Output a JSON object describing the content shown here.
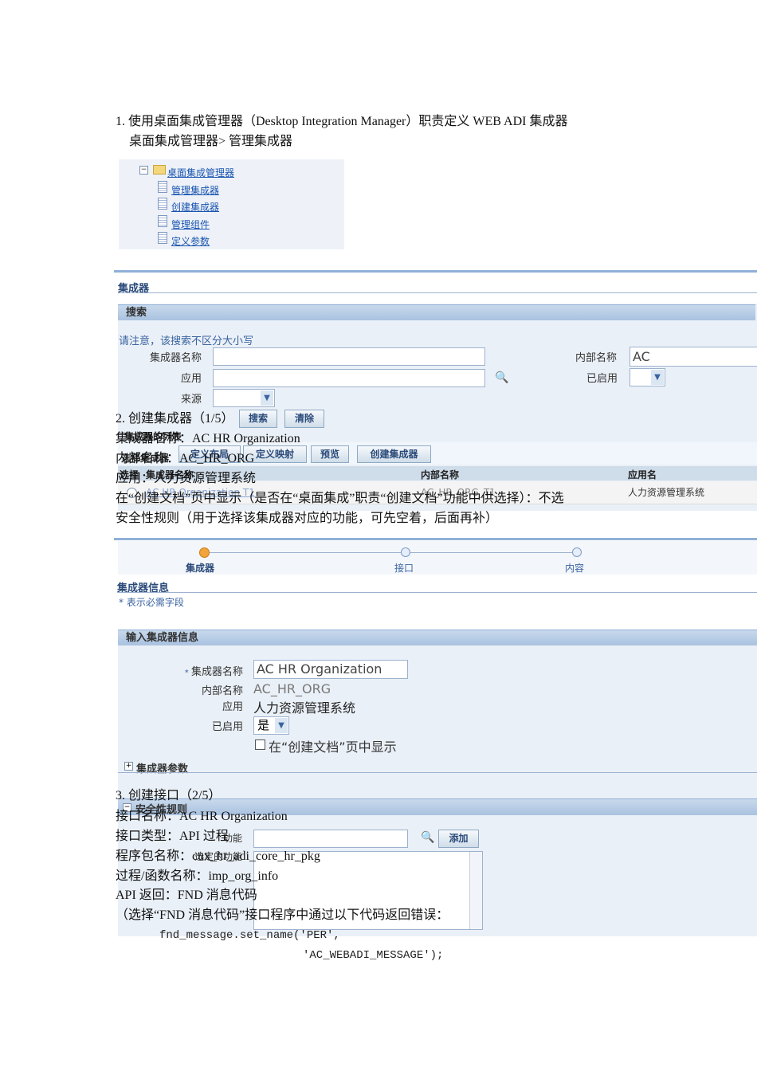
{
  "doc": {
    "step1": "1.  使用桌面集成管理器（Desktop Integration Manager）职责定义 WEB ADI 集成器",
    "step1_path": "桌面集成管理器>  管理集成器",
    "step2": "2.  创建集成器（1/5）",
    "integrator_name": "集成器名称：AC HR Organization",
    "internal_name": "内部名称：AC_HR_ORG",
    "application": "应用：人力资源管理系统",
    "display_in_create": "在“创建文档”页中显示（是否在“桌面集成”职责“创建文档”功能中供选择）：不选",
    "security_rules": "安全性规则（用于选择该集成器对应的功能，可先空着，后面再补）",
    "step3": "3.  创建接口（2/5）",
    "interface_name": "接口名称：AC HR Organization",
    "interface_type": "接口类型：API  过程",
    "package_name": "程序包名称：cux_hr_adi_core_hr_pkg",
    "procedure_name": "过程/函数名称：imp_org_info",
    "api_return": "API 返回：FND 消息代码",
    "fnd_note": "（选择“FND 消息代码”接口程序中通过以下代码返回错误：",
    "code_line1": "fnd_message.set_name('PER',",
    "code_line2": "'AC_WEBADI_MESSAGE');"
  },
  "tree": {
    "root": "桌面集成管理器",
    "items": [
      "管理集成器",
      "创建集成器",
      "管理组件",
      "定义参数"
    ]
  },
  "search_screen": {
    "title": "集成器",
    "search_section": "搜索",
    "notice": "请注意，该搜索不区分大小写",
    "name_label": "集成器名称",
    "app_label": "应用",
    "source_label": "来源",
    "internal_label": "内部名称",
    "internal_value": "AC",
    "enabled_label": "已启用",
    "search_btn": "搜索",
    "clear_btn": "清除",
    "list_title": "集成器的列表",
    "select_label": "选择集成器",
    "buttons": [
      "定义布局",
      "定义映射",
      "预览",
      "创建集成器"
    ],
    "columns": [
      "选择",
      "集成器名称",
      "内部名称",
      "应用名"
    ],
    "rows": [
      {
        "name": "AC HR Organization T1",
        "internal": "AC_HR_ORG_T1",
        "app": "人力资源管理系统"
      }
    ]
  },
  "create_screen": {
    "train": [
      "集成器",
      "接口",
      "内容"
    ],
    "info_title": "集成器信息",
    "required_note": "* 表示必需字段",
    "section": "输入集成器信息",
    "name_label": "集成器名称",
    "name_value": "AC HR Organization",
    "internal_label": "内部名称",
    "internal_value": "AC_HR_ORG",
    "app_label": "应用",
    "app_value": "人力资源管理系统",
    "enabled_label": "已启用",
    "enabled_value": "是",
    "display_checkbox": "在“创建文档”页中显示",
    "params_section": "集成器参数",
    "security_section": "安全性规则",
    "function_label": "功能",
    "add_btn": "添加",
    "selected_label": "选定的功能"
  },
  "colors": {
    "accent": "#2b4a7a",
    "bar": "#a9c2e0",
    "panel": "#eaf0f7"
  }
}
